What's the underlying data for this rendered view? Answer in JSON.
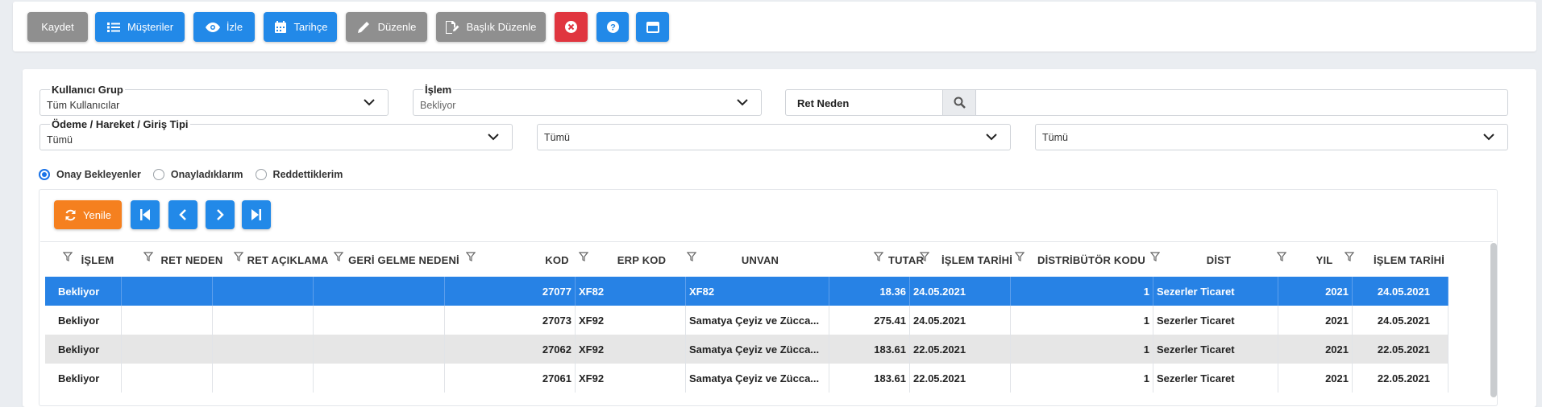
{
  "toolbar": {
    "buttons": [
      {
        "label": "Kaydet",
        "icon": "none",
        "color": "#8f8f8f"
      },
      {
        "label": "Müşteriler",
        "icon": "list-icon",
        "color": "#2289e8"
      },
      {
        "label": "İzle",
        "icon": "eye-icon",
        "color": "#2289e8"
      },
      {
        "label": "Tarihçe",
        "icon": "calendar-icon",
        "color": "#2289e8"
      },
      {
        "label": "Düzenle",
        "icon": "pencil-icon",
        "color": "#8f8f8f"
      },
      {
        "label": "Başlık Düzenle",
        "icon": "edit-doc-icon",
        "color": "#8f8f8f"
      },
      {
        "label": "",
        "icon": "close-circle-icon",
        "color": "#e0353f"
      },
      {
        "label": "",
        "icon": "help-icon",
        "color": "#2289e8"
      },
      {
        "label": "",
        "icon": "window-icon",
        "color": "#2289e8"
      }
    ]
  },
  "filters": {
    "user_group": {
      "label": "Kullanıcı Grup",
      "value": "Tüm Kullanıcılar"
    },
    "process": {
      "label": "İşlem",
      "value": "Bekliyor"
    },
    "reject_reason": {
      "label": "Ret Neden",
      "value": ""
    },
    "payment_type": {
      "label": "Ödeme / Hareket / Giriş Tipi",
      "value": "Tümü"
    },
    "select2": {
      "value": "Tümü"
    },
    "select3": {
      "value": "Tümü"
    }
  },
  "radios": [
    {
      "label": "Onay Bekleyenler",
      "checked": true
    },
    {
      "label": "Onayladıklarım",
      "checked": false
    },
    {
      "label": "Reddettiklerim",
      "checked": false
    }
  ],
  "nav": {
    "refresh_label": "Yenile",
    "first_icon": "first-page-icon",
    "prev_icon": "chevron-left-icon",
    "next_icon": "chevron-right-icon",
    "last_icon": "last-page-icon"
  },
  "table": {
    "columns": [
      "İŞLEM",
      "RET NEDEN",
      "RET AÇIKLAMA",
      "GERİ GELME NEDENİ",
      "KOD",
      "ERP KOD",
      "UNVAN",
      "TUTAR",
      "İŞLEM TARİHİ",
      "DİSTRİBÜTÖR KODU",
      "DİST",
      "YIL",
      "İŞLEM TARİHİ"
    ],
    "rows": [
      [
        "Bekliyor",
        "",
        "",
        "",
        "27077",
        "XF82",
        "XF82",
        "18.36",
        "24.05.2021",
        "1",
        "Sezerler Ticaret",
        "2021",
        "24.05.2021"
      ],
      [
        "Bekliyor",
        "",
        "",
        "",
        "27073",
        "XF92",
        "Samatya Çeyiz ve Zücca...",
        "275.41",
        "24.05.2021",
        "1",
        "Sezerler Ticaret",
        "2021",
        "24.05.2021"
      ],
      [
        "Bekliyor",
        "",
        "",
        "",
        "27062",
        "XF92",
        "Samatya Çeyiz ve Zücca...",
        "183.61",
        "22.05.2021",
        "1",
        "Sezerler Ticaret",
        "2021",
        "22.05.2021"
      ],
      [
        "Bekliyor",
        "",
        "",
        "",
        "27061",
        "XF92",
        "Samatya Çeyiz ve Zücca...",
        "183.61",
        "22.05.2021",
        "1",
        "Sezerler Ticaret",
        "2021",
        "22.05.2021"
      ]
    ],
    "selected_row": 0
  },
  "colors": {
    "primary": "#2289e8",
    "selected_row": "#2782e5",
    "refresh": "#f5801f",
    "danger": "#e0353f",
    "neutral": "#8f8f8f"
  }
}
